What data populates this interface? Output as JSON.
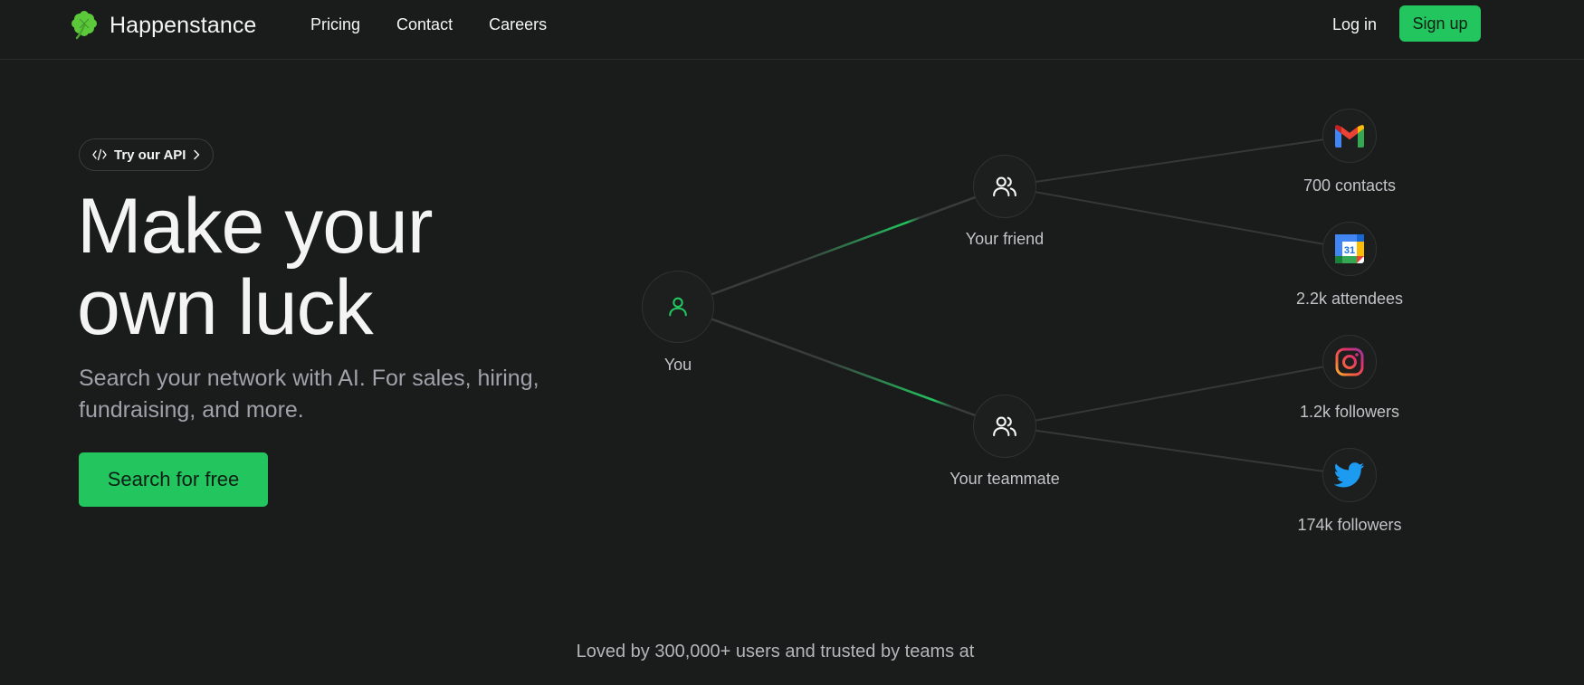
{
  "nav": {
    "brand": "Happenstance",
    "links": [
      "Pricing",
      "Contact",
      "Careers"
    ],
    "login": "Log in",
    "signup": "Sign up"
  },
  "hero": {
    "api_pill": "Try our API",
    "title_line1": "Make your",
    "title_line2": "own luck",
    "subtitle": "Search your network with AI. For sales, hiring, fundraising, and more.",
    "cta": "Search for free"
  },
  "graph": {
    "you": "You",
    "friend": "Your friend",
    "teammate": "Your teammate",
    "sources": [
      {
        "icon": "gmail-icon",
        "label": "700 contacts"
      },
      {
        "icon": "google-calendar-icon",
        "label": "2.2k attendees"
      },
      {
        "icon": "instagram-icon",
        "label": "1.2k followers"
      },
      {
        "icon": "twitter-icon",
        "label": "174k followers"
      }
    ],
    "calendar_day": "31"
  },
  "footer_note": "Loved by 300,000+ users and trusted by teams at",
  "colors": {
    "background": "#1a1b1b",
    "accent": "#22c55e"
  }
}
